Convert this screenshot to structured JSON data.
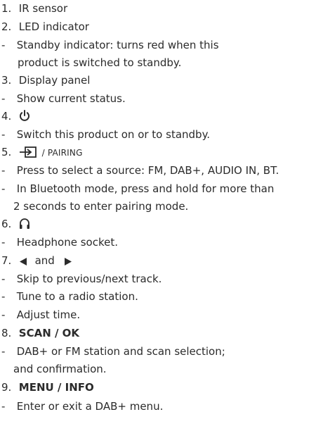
{
  "items": [
    {
      "num": "1.",
      "title": "IR sensor"
    },
    {
      "num": "2.",
      "title": "LED indicator",
      "desc1": "Standby indicator: turns red when this",
      "desc1_cont": "product is switched to standby."
    },
    {
      "num": "3.",
      "title": "Display panel",
      "desc1": "Show current status."
    },
    {
      "num": "4.",
      "icon": "power-icon",
      "desc1": "Switch this product on or to standby."
    },
    {
      "num": "5.",
      "icon": "source-input-icon",
      "title_suffix": "/ PAIRING",
      "desc1": "Press to select a source: FM, DAB+, AUDIO IN, BT.",
      "desc2": "In Bluetooth mode, press and hold for more than",
      "desc2_cont": "2 seconds to enter pairing mode."
    },
    {
      "num": "6.",
      "icon": "headphone-icon",
      "desc1": "Headphone socket."
    },
    {
      "num": "7.",
      "icon_left": "prev-triangle-icon",
      "and": "and",
      "icon_right": "next-triangle-icon",
      "desc1": "Skip to previous/next track.",
      "desc2": "Tune to a radio station.",
      "desc3": "Adjust time."
    },
    {
      "num": "8.",
      "title": "SCAN / OK",
      "desc1": "DAB+ or FM station and scan selection;",
      "desc1_cont": "and confirmation."
    },
    {
      "num": "9.",
      "title": "MENU / INFO",
      "desc1": "Enter or exit a DAB+ menu."
    }
  ],
  "dash": "-"
}
